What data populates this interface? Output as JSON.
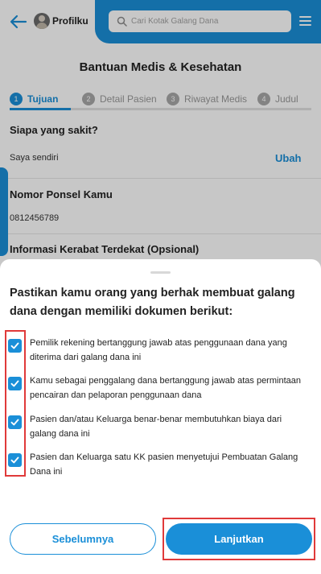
{
  "header": {
    "profile_label": "Profilku",
    "search_placeholder": "Cari Kotak Galang Dana"
  },
  "page": {
    "title": "Bantuan Medis & Kesehatan",
    "steps": [
      {
        "num": "1",
        "label": "Tujuan",
        "active": true
      },
      {
        "num": "2",
        "label": "Detail Pasien",
        "active": false
      },
      {
        "num": "3",
        "label": "Riwayat Medis",
        "active": false
      },
      {
        "num": "4",
        "label": "Judul",
        "active": false
      }
    ],
    "who_sick": {
      "label": "Siapa yang sakit?",
      "value": "Saya sendiri",
      "action": "Ubah"
    },
    "phone": {
      "label": "Nomor Ponsel Kamu",
      "value": "0812456789"
    },
    "relative": {
      "label": "Informasi Kerabat Terdekat (Opsional)"
    }
  },
  "sheet": {
    "title": "Pastikan kamu orang yang berhak membuat galang dana dengan memiliki dokumen berikut:",
    "items": [
      {
        "text": "Pemilik rekening bertanggung jawab atas penggunaan dana yang diterima dari galang dana ini",
        "checked": true
      },
      {
        "text": "Kamu sebagai penggalang dana bertanggung jawab atas permintaan pencairan dan pelaporan penggunaan dana",
        "checked": true
      },
      {
        "text": "Pasien dan/atau Keluarga benar-benar membutuhkan biaya dari galang dana ini",
        "checked": true
      },
      {
        "text": "Pasien dan Keluarga satu KK pasien menyetujui Pembuatan Galang Dana ini",
        "checked": true
      }
    ],
    "prev_label": "Sebelumnya",
    "next_label": "Lanjutkan"
  },
  "colors": {
    "primary": "#1a8fd8",
    "highlight": "#e03a3a"
  }
}
